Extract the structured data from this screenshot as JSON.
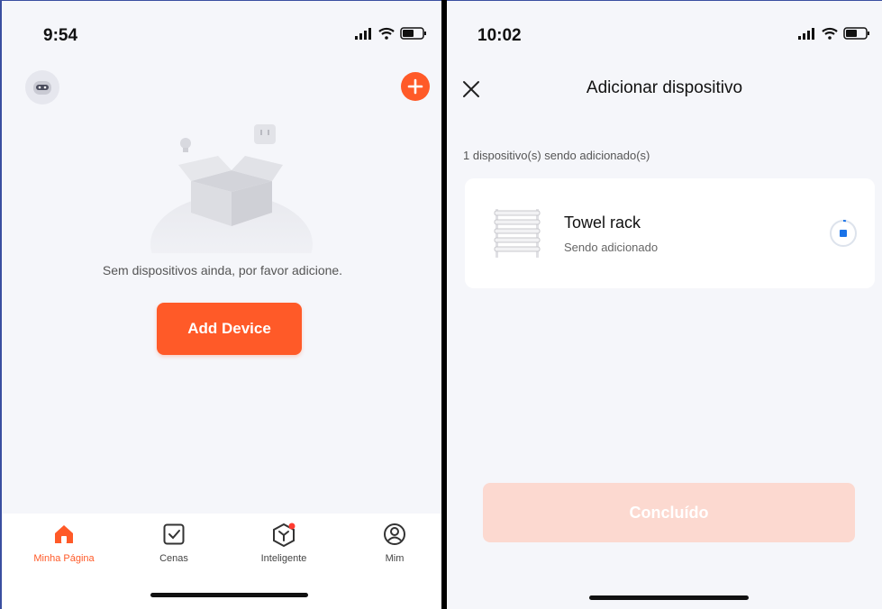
{
  "left": {
    "status_time": "9:54",
    "empty_message": "Sem dispositivos ainda, por favor adicione.",
    "add_device_label": "Add Device",
    "tabs": [
      {
        "label": "Minha Página",
        "icon": "home-icon",
        "active": true
      },
      {
        "label": "Cenas",
        "icon": "scene-checkbox-icon",
        "active": false
      },
      {
        "label": "Inteligente",
        "icon": "smart-hexagon-icon",
        "active": false,
        "badge": true
      },
      {
        "label": "Mim",
        "icon": "profile-icon",
        "active": false
      }
    ]
  },
  "right": {
    "status_time": "10:02",
    "title": "Adicionar dispositivo",
    "sub_info": "1 dispositivo(s) sendo adicionado(s)",
    "device": {
      "name": "Towel rack",
      "status": "Sendo adicionado"
    },
    "done_label": "Concluído"
  },
  "colors": {
    "accent": "#ff5a28",
    "accent_disabled": "#fcd9d0",
    "background": "#f5f6fa",
    "progress_blue": "#1a73e8"
  }
}
